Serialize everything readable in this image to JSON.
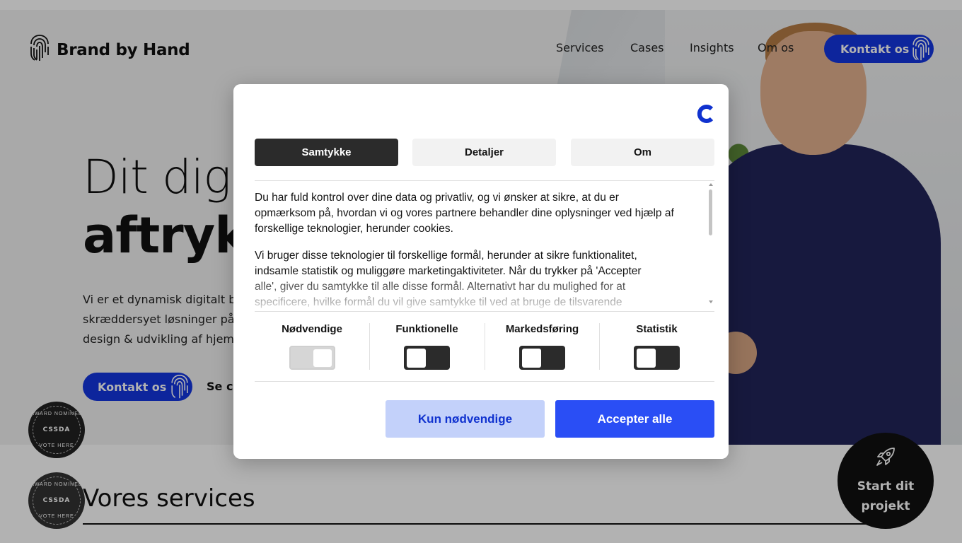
{
  "site": {
    "brand": "Brand by Hand",
    "nav": [
      "Services",
      "Cases",
      "Insights",
      "Om os"
    ],
    "contact_button": "Kontakt os",
    "hero_line1": "Dit dig",
    "hero_line2": "aftryk",
    "hero_paragraph": [
      "Vi er et dynamisk digitalt bu",
      "skræddersyet løsninger på",
      "design & udvikling af hjemm"
    ],
    "hero_contact_button": "Kontakt os",
    "see_cases_link": "Se ca",
    "badge": {
      "top": "AWARD NOMINEE",
      "mark": "CSSDA",
      "bottom": "VOTE HERE"
    },
    "services_title": "Vores services",
    "start_project": "Start dit projekt"
  },
  "consent": {
    "tabs": [
      "Samtykke",
      "Detaljer",
      "Om"
    ],
    "active_tab": "Samtykke",
    "paragraph1": "Du har fuld kontrol over dine data og privatliv, og vi ønsker at sikre, at du er opmærksom på, hvordan vi og vores partnere behandler dine oplysninger ved hjælp af forskellige teknologier, herunder cookies.",
    "paragraph2": "Vi bruger disse teknologier til forskellige formål, herunder at sikre funktionalitet, indsamle statistik og muliggøre marketingaktiviteter. Når du trykker på 'Accepter alle', giver du samtykke til alle disse formål. Alternativt har du mulighed for at specificere, hvilke formål du vil give samtykke til ved at bruge de tilsvarende",
    "categories": [
      {
        "label": "Nødvendige",
        "enabled": true,
        "locked": true
      },
      {
        "label": "Funktionelle",
        "enabled": false,
        "locked": false
      },
      {
        "label": "Markedsføring",
        "enabled": false,
        "locked": false
      },
      {
        "label": "Statistik",
        "enabled": false,
        "locked": false
      }
    ],
    "buttons": {
      "necessary_only": "Kun nødvendige",
      "accept_all": "Accepter alle"
    }
  },
  "colors": {
    "accent_blue": "#2a4ef5",
    "brand_blue": "#1436e0",
    "dark": "#2b2b2b",
    "light_blue": "#c3d1fa"
  },
  "icons": [
    "fingerprint-icon",
    "cookiebot-logo-icon",
    "rocket-icon",
    "award-badge-icon"
  ]
}
